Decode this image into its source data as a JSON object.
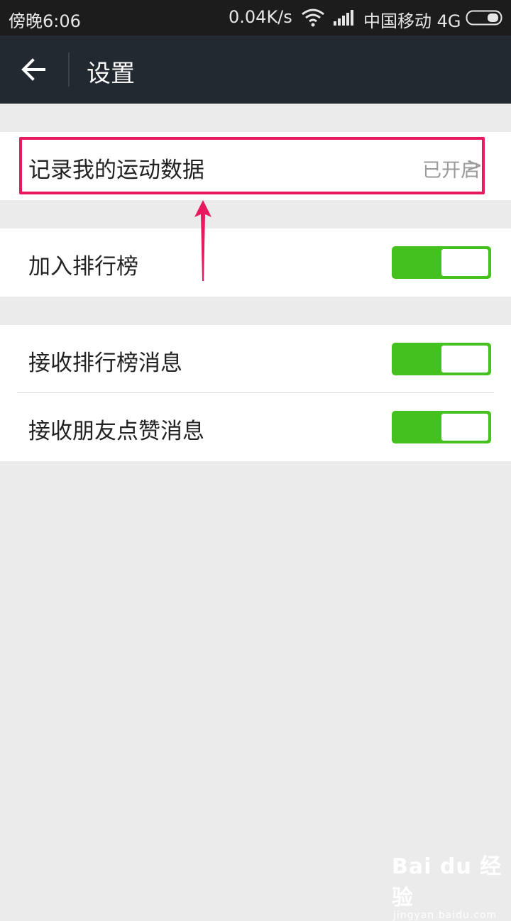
{
  "status_bar": {
    "time": "傍晚6:06",
    "network_speed": "0.04K/s",
    "carrier": "中国移动 4G",
    "icons": [
      "wifi-icon",
      "signal-icon",
      "battery-icon"
    ]
  },
  "header": {
    "title": "设置",
    "back_icon": "back-arrow-icon"
  },
  "settings": {
    "record_sport": {
      "label": "记录我的运动数据",
      "value": "已开启",
      "chevron": ">"
    },
    "join_ranking": {
      "label": "加入排行榜",
      "enabled": true
    },
    "receive_ranking_msg": {
      "label": "接收排行榜消息",
      "enabled": true
    },
    "receive_like_msg": {
      "label": "接收朋友点赞消息",
      "enabled": true
    }
  },
  "annotation": {
    "highlight_color": "#e8195d",
    "icons": [
      "highlight-box",
      "pointer-arrow-icon"
    ]
  },
  "watermark": {
    "brand": "Bai du 经验",
    "url": "jingyan.baidu.com"
  },
  "colors": {
    "toggle_on": "#44c01f",
    "header_bg": "#222930",
    "page_bg": "#ebebeb"
  }
}
